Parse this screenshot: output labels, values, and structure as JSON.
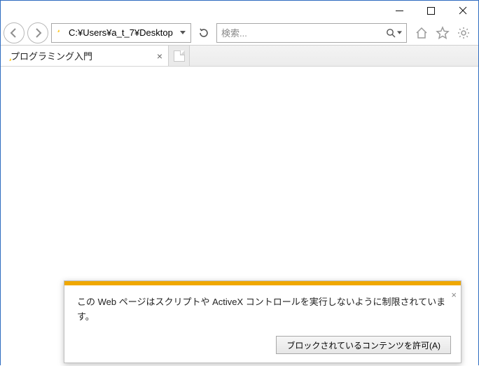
{
  "address_bar": {
    "url": "C:¥Users¥a_t_7¥Desktop"
  },
  "search": {
    "placeholder": "検索..."
  },
  "tab": {
    "title": "プログラミング入門"
  },
  "notification": {
    "message": "この Web ページはスクリプトや ActiveX コントロールを実行しないように制限されています。",
    "allow_button": "ブロックされているコンテンツを許可(A)"
  }
}
